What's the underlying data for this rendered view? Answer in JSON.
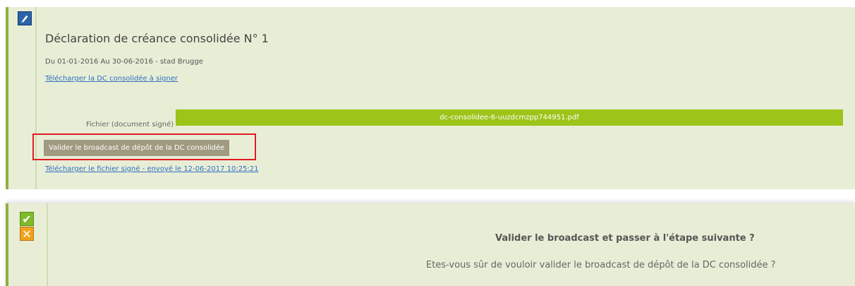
{
  "claim": {
    "title": "Déclaration de créance consolidée N° 1",
    "period": "Du 01-01-2016 Au 30-06-2016 - stad Brugge",
    "download_link": "Télécharger la DC consolidée à signer",
    "file_label": "Fichier (document signé)",
    "file_name": "dc-consolidee-6-uuzdcmzpp744951.pdf",
    "validate_button": "Valider le broadcast de dépôt de la DC consolidée",
    "signed_link": "Télécharger le fichier signé - envoyé le 12-06-2017 10:25:21"
  },
  "confirm": {
    "question": "Valider le broadcast et passer à l'étape suivante ?",
    "message": "Etes-vous sûr de vouloir valider le broadcast de dépôt de la DC consolidée ?",
    "confirm_symbol": "✔",
    "cancel_symbol": "✕"
  },
  "colors": {
    "panel_bg": "#e8eed6",
    "accent_green": "#9cc419",
    "button_bg": "#9f9a80",
    "highlight_red": "#e21b23",
    "edit_blue": "#2a64a6",
    "cancel_orange": "#f0a21f"
  },
  "icons": [
    "pencil-icon",
    "checkmark-icon",
    "cross-icon"
  ]
}
